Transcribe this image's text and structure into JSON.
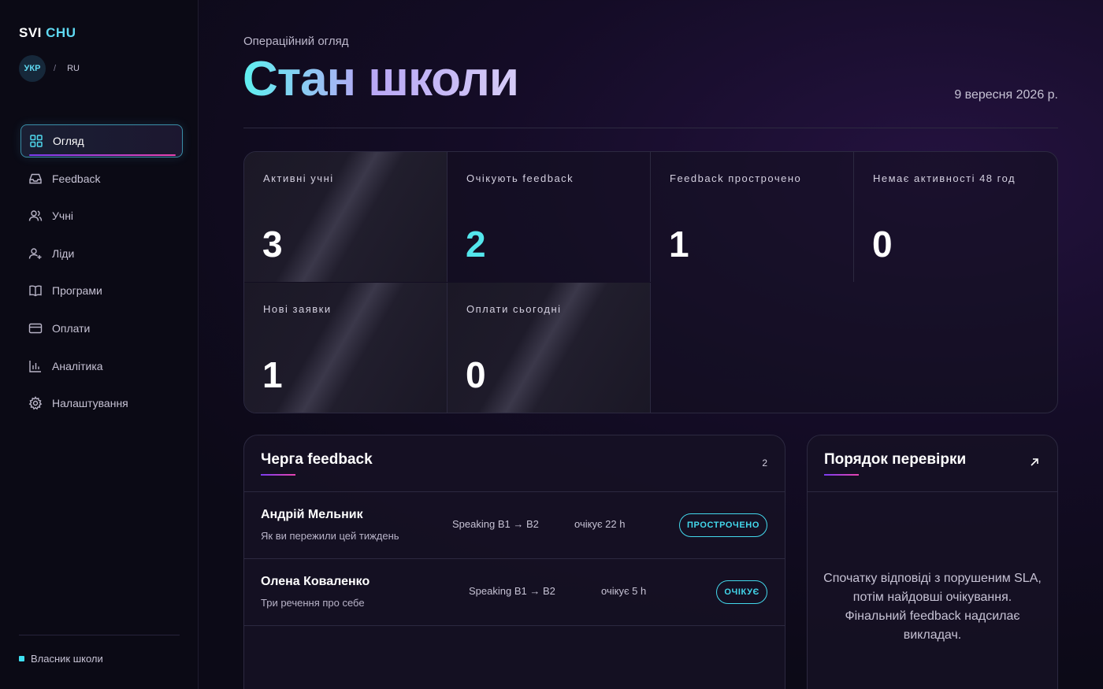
{
  "brand": {
    "part1": "SVI",
    "part2": "CHU"
  },
  "language": {
    "active": "УКР",
    "separator": "/",
    "other": "RU"
  },
  "sidebar": {
    "items": [
      {
        "label": "Огляд",
        "icon": "grid-icon"
      },
      {
        "label": "Feedback",
        "icon": "inbox-icon"
      },
      {
        "label": "Учні",
        "icon": "users-icon"
      },
      {
        "label": "Ліди",
        "icon": "user-plus-icon"
      },
      {
        "label": "Програми",
        "icon": "book-icon"
      },
      {
        "label": "Оплати",
        "icon": "card-icon"
      },
      {
        "label": "Аналітика",
        "icon": "bar-chart-icon"
      },
      {
        "label": "Налаштування",
        "icon": "gear-icon"
      }
    ],
    "role": "Власник школи"
  },
  "header": {
    "eyebrow": "Операційний огляд",
    "title": "Стан школи",
    "date": "9 вересня 2026 р."
  },
  "stats": [
    {
      "label": "Активні учні",
      "value": "3"
    },
    {
      "label": "Очікують feedback",
      "value": "2"
    },
    {
      "label": "Feedback прострочено",
      "value": "1"
    },
    {
      "label": "Немає активності 48 год",
      "value": "0"
    },
    {
      "label": "Нові заявки",
      "value": "1"
    },
    {
      "label": "Оплати сьогодні",
      "value": "0"
    }
  ],
  "queue": {
    "title": "Черга feedback",
    "count": "2",
    "rows": [
      {
        "name": "Андрій Мельник",
        "subtitle": "Як ви пережили цей тиждень",
        "program": "Speaking B1 → B2",
        "wait": "очікує 22 h",
        "status": "ПРОСТРОЧЕНО"
      },
      {
        "name": "Олена Коваленко",
        "subtitle": "Три речення про себе",
        "program": "Speaking B1 → B2",
        "wait": "очікує 5 h",
        "status": "ОЧІКУЄ"
      }
    ]
  },
  "review": {
    "title": "Порядок перевірки",
    "text": "Спочатку відповіді з порушеним SLA, потім найдовші очікування. Фінальний feedback надсилає викладач."
  },
  "colors": {
    "accent": "#54e6ec",
    "gradient_start": "#7a3cf0",
    "gradient_end": "#e844b0"
  }
}
